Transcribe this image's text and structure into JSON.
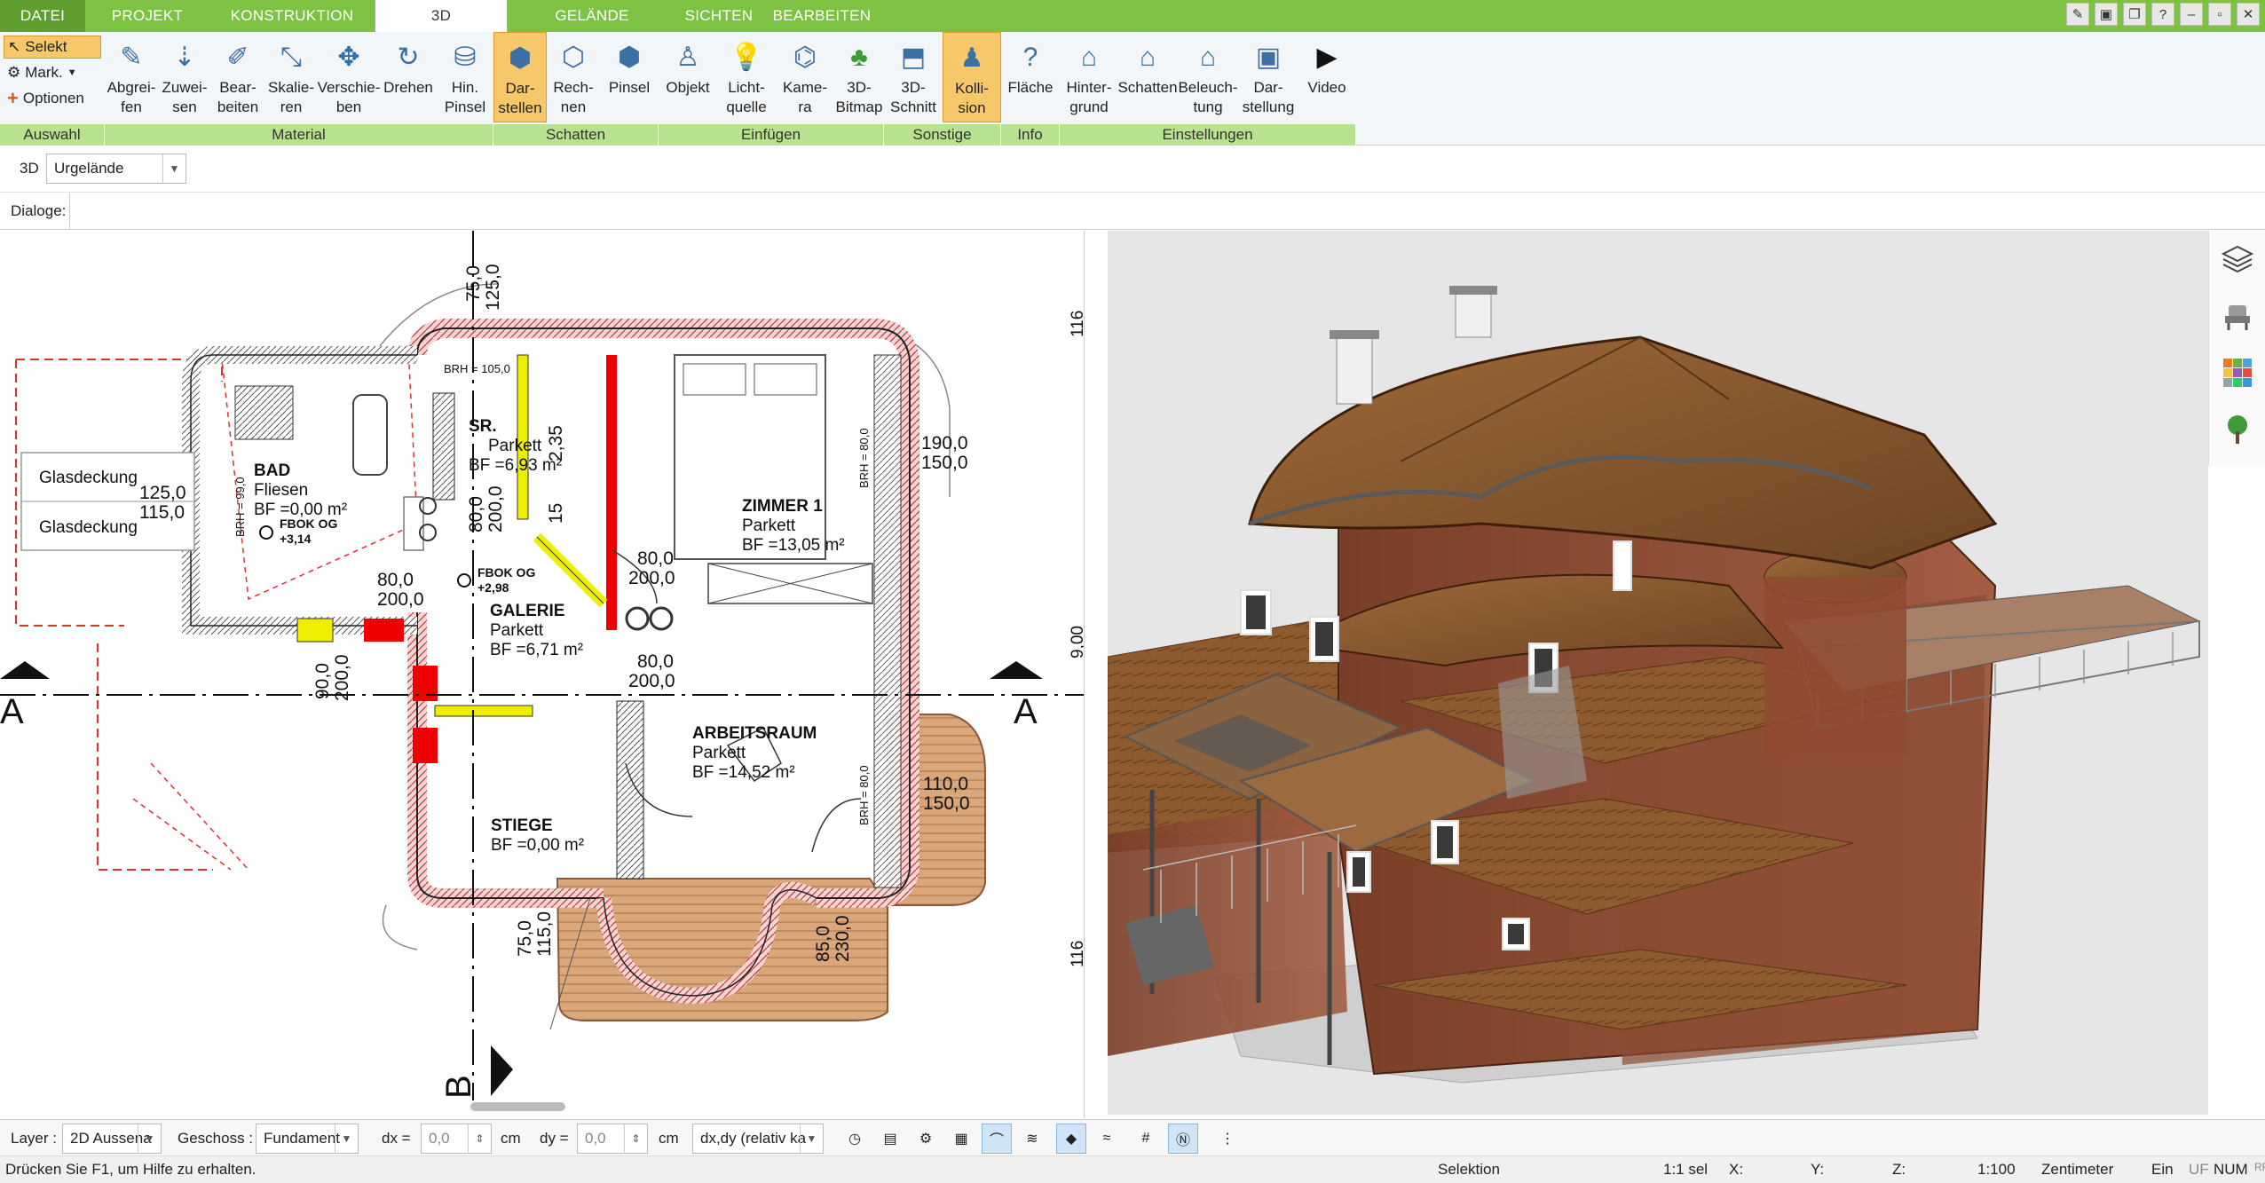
{
  "tabs": [
    "DATEI",
    "PROJEKT",
    "KONSTRUKTION",
    "3D",
    "GELÄNDE",
    "SICHTEN",
    "BEARBEITEN"
  ],
  "ribbon": {
    "auswahl": {
      "label": "Auswahl",
      "selekt": "Selekt",
      "mark": "Mark.",
      "optionen": "Optionen"
    },
    "material": {
      "label": "Material",
      "buttons": [
        "Abgrei-\nfen",
        "Zuwei-\nsen",
        "Bear-\nbeiten",
        "Skalie-\nren",
        "Verschie-\nben",
        "Drehen",
        "Hin.\nPinsel"
      ]
    },
    "schatten": {
      "label": "Schatten",
      "buttons": [
        "Dar-\nstellen",
        "Rech-\nnen",
        "Pinsel"
      ]
    },
    "einfuegen": {
      "label": "Einfügen",
      "buttons": [
        "Objekt",
        "Licht-\nquelle",
        "Kame-\nra",
        "3D-\nBitmap"
      ]
    },
    "sonstige": {
      "label": "Sonstige",
      "buttons": [
        "3D-\nSchnitt",
        "Kolli-\nsion"
      ]
    },
    "info": {
      "label": "Info",
      "buttons": [
        "Fläche"
      ]
    },
    "einstellungen": {
      "label": "Einstellungen",
      "buttons": [
        "Hinter-\ngrund",
        "Schatten",
        "Beleuch-\ntung",
        "Dar-\nstellung",
        "Video"
      ]
    }
  },
  "view": {
    "mode": "3D",
    "terrain": "Urgelände",
    "dialoge": "Dialoge:"
  },
  "plan": {
    "rooms": [
      {
        "name": "BAD",
        "floor": "Fliesen",
        "area": "BF =0,00 m²"
      },
      {
        "name": "SR.",
        "floor": "Parkett",
        "area": "BF =6,93 m²"
      },
      {
        "name": "ZIMMER 1",
        "floor": "Parkett",
        "area": "BF =13,05 m²"
      },
      {
        "name": "GALERIE",
        "floor": "Parkett",
        "area": "BF =6,71 m²"
      },
      {
        "name": "ARBEITSRAUM",
        "floor": "Parkett",
        "area": "BF =14,52 m²"
      },
      {
        "name": "STIEGE",
        "floor": "",
        "area": "BF =0,00 m²"
      }
    ],
    "glass": [
      "Glasdeckung",
      "Glasdeckung"
    ],
    "dims": [
      "75,0",
      "125,0",
      "190,0",
      "150,0",
      "125,0",
      "115,0",
      "80,0",
      "200,0",
      "80,0",
      "200,0",
      "80,0",
      "200,0",
      "80,0",
      "200,0",
      "90,0",
      "200,0",
      "110,0",
      "150,0",
      "75,0",
      "115,0",
      "85,0",
      "230,0",
      "2,35",
      "15",
      "116",
      "116",
      "9,00"
    ],
    "brh": [
      "BRH = 105,0",
      "BRH = 80,0",
      "BRH = 99,0",
      "BRH = 80,0"
    ],
    "fbok": [
      {
        "label": "FBOK OG",
        "value": "+3,14"
      },
      {
        "label": "FBOK OG",
        "value": "+2,98"
      }
    ],
    "section": [
      "A",
      "A",
      "B"
    ]
  },
  "bottom": {
    "layer_label": "Layer :",
    "layer_value": "2D Aussena",
    "geschoss_label": "Geschoss :",
    "geschoss_value": "Fundament",
    "dx_label": "dx =",
    "dx_value": "0,0",
    "dx_unit": "cm",
    "dy_label": "dy =",
    "dy_value": "0,0",
    "dy_unit": "cm",
    "mode_value": "dx,dy (relativ ka"
  },
  "status": {
    "hint": "Drücken Sie F1, um Hilfe zu erhalten.",
    "mode": "Selektion",
    "sel": "1:1 sel",
    "x": "X:",
    "y": "Y:",
    "z": "Z:",
    "scale": "1:100",
    "unit": "Zentimeter",
    "ein": "Ein",
    "uf": "UF",
    "num": "NUM",
    "rf": "RF"
  },
  "colors": {
    "tabbar": "#7dc242",
    "group_label": "#b8e28f",
    "selected": "#f7c86a"
  }
}
